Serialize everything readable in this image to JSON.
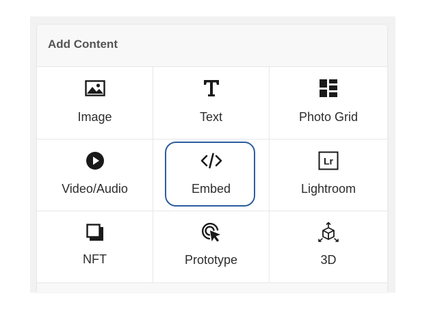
{
  "panel": {
    "title": "Add Content"
  },
  "tiles": [
    {
      "label": "Image",
      "icon": "image-icon"
    },
    {
      "label": "Text",
      "icon": "text-icon"
    },
    {
      "label": "Photo Grid",
      "icon": "photo-grid-icon"
    },
    {
      "label": "Video/Audio",
      "icon": "video-audio-icon"
    },
    {
      "label": "Embed",
      "icon": "embed-code-icon",
      "selected": true
    },
    {
      "label": "Lightroom",
      "icon": "lightroom-icon"
    },
    {
      "label": "NFT",
      "icon": "nft-icon"
    },
    {
      "label": "Prototype",
      "icon": "prototype-cursor-icon"
    },
    {
      "label": "3D",
      "icon": "3d-cube-icon"
    }
  ],
  "colors": {
    "selection_border": "#2c5d9f",
    "icon": "#1a1a1a",
    "header_bg": "#f8f8f8"
  }
}
